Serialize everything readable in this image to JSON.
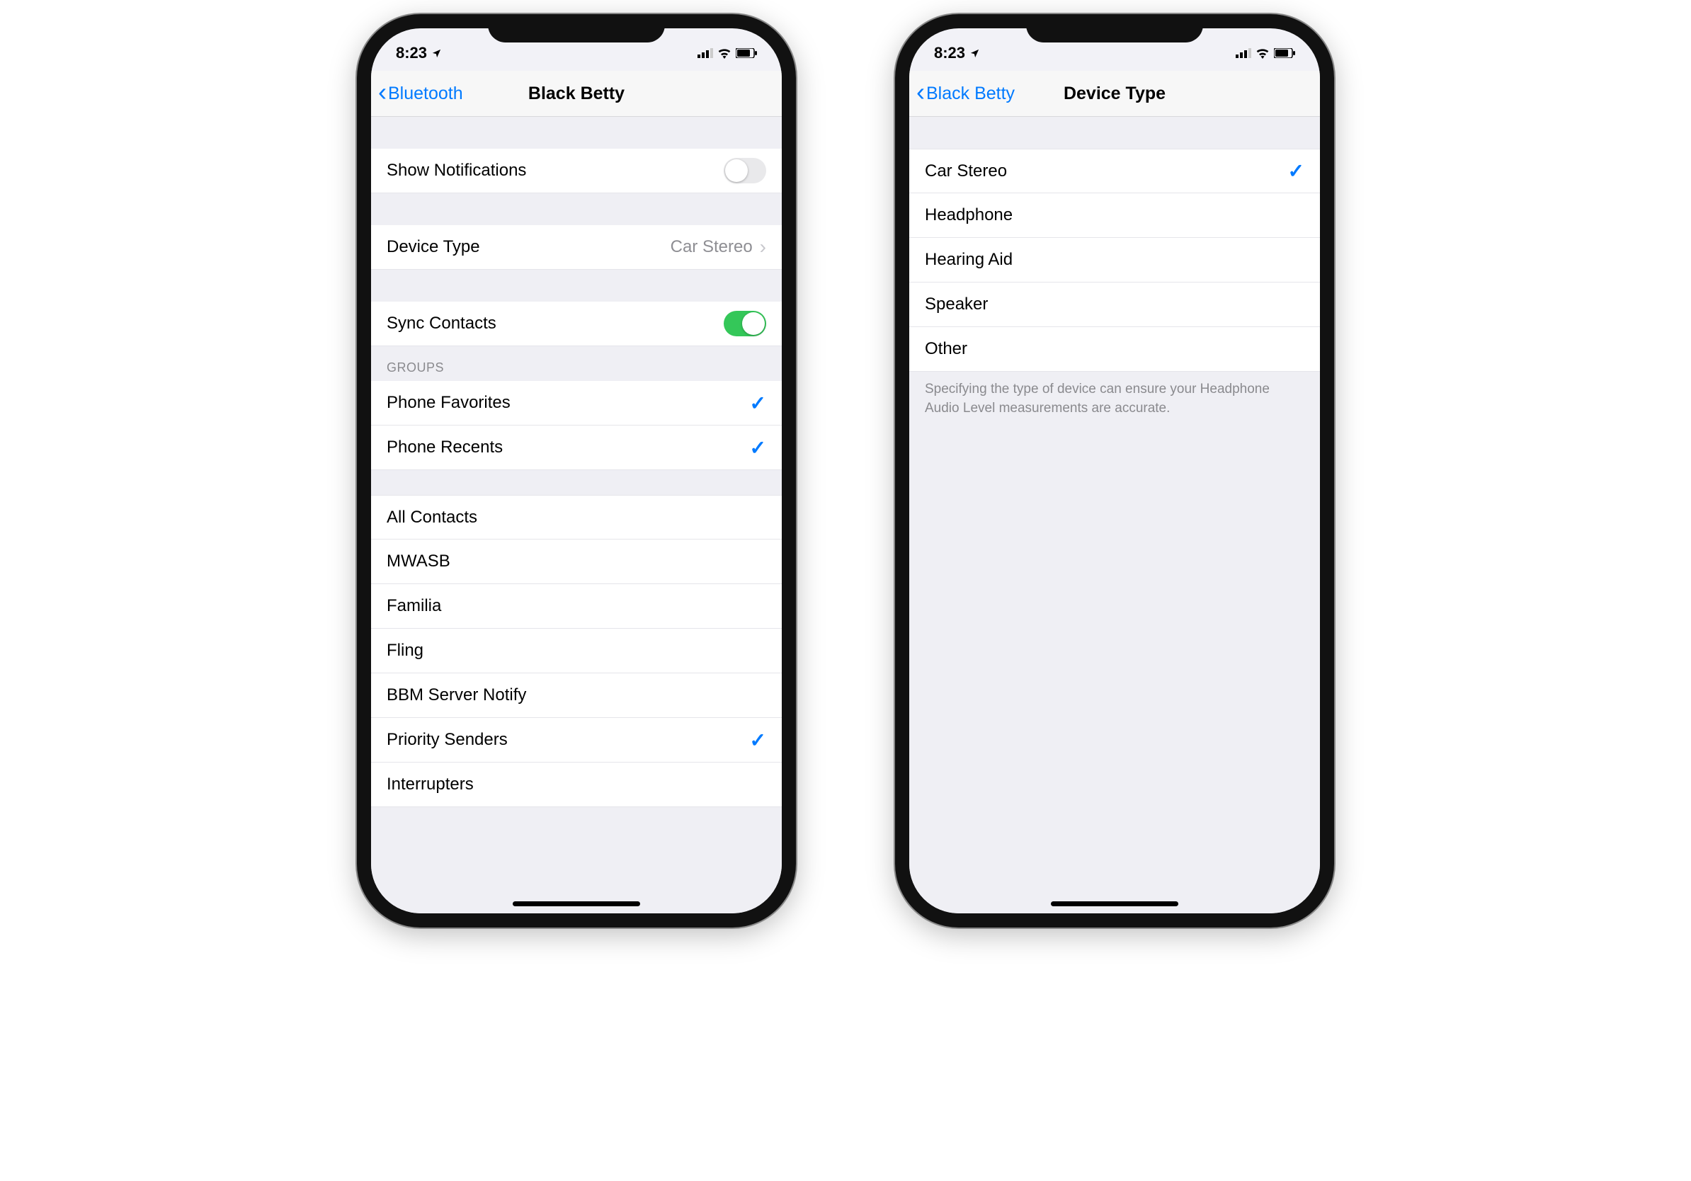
{
  "status": {
    "time": "8:23",
    "location_icon": "location-icon",
    "signal_icon": "signal-icon",
    "wifi_icon": "wifi-icon",
    "battery_icon": "battery-icon"
  },
  "left_phone": {
    "nav": {
      "back": "Bluetooth",
      "title": "Black Betty"
    },
    "rows": {
      "show_notifications": {
        "label": "Show Notifications",
        "on": false
      },
      "device_type": {
        "label": "Device Type",
        "value": "Car Stereo"
      },
      "sync_contacts": {
        "label": "Sync Contacts",
        "on": true
      },
      "groups_header": "GROUPS",
      "phone_favorites": {
        "label": "Phone Favorites",
        "checked": true
      },
      "phone_recents": {
        "label": "Phone Recents",
        "checked": true
      },
      "contacts": [
        {
          "label": "All Contacts",
          "checked": false
        },
        {
          "label": "MWASB",
          "checked": false
        },
        {
          "label": "Familia",
          "checked": false
        },
        {
          "label": "Fling",
          "checked": false
        },
        {
          "label": "BBM Server Notify",
          "checked": false
        },
        {
          "label": "Priority Senders",
          "checked": true
        },
        {
          "label": "Interrupters",
          "checked": false
        }
      ]
    }
  },
  "right_phone": {
    "nav": {
      "back": "Black Betty",
      "title": "Device Type"
    },
    "options": [
      {
        "label": "Car Stereo",
        "selected": true
      },
      {
        "label": "Headphone",
        "selected": false
      },
      {
        "label": "Hearing Aid",
        "selected": false
      },
      {
        "label": "Speaker",
        "selected": false
      },
      {
        "label": "Other",
        "selected": false
      }
    ],
    "footer": "Specifying the type of device can ensure your Headphone Audio Level measurements are accurate."
  }
}
